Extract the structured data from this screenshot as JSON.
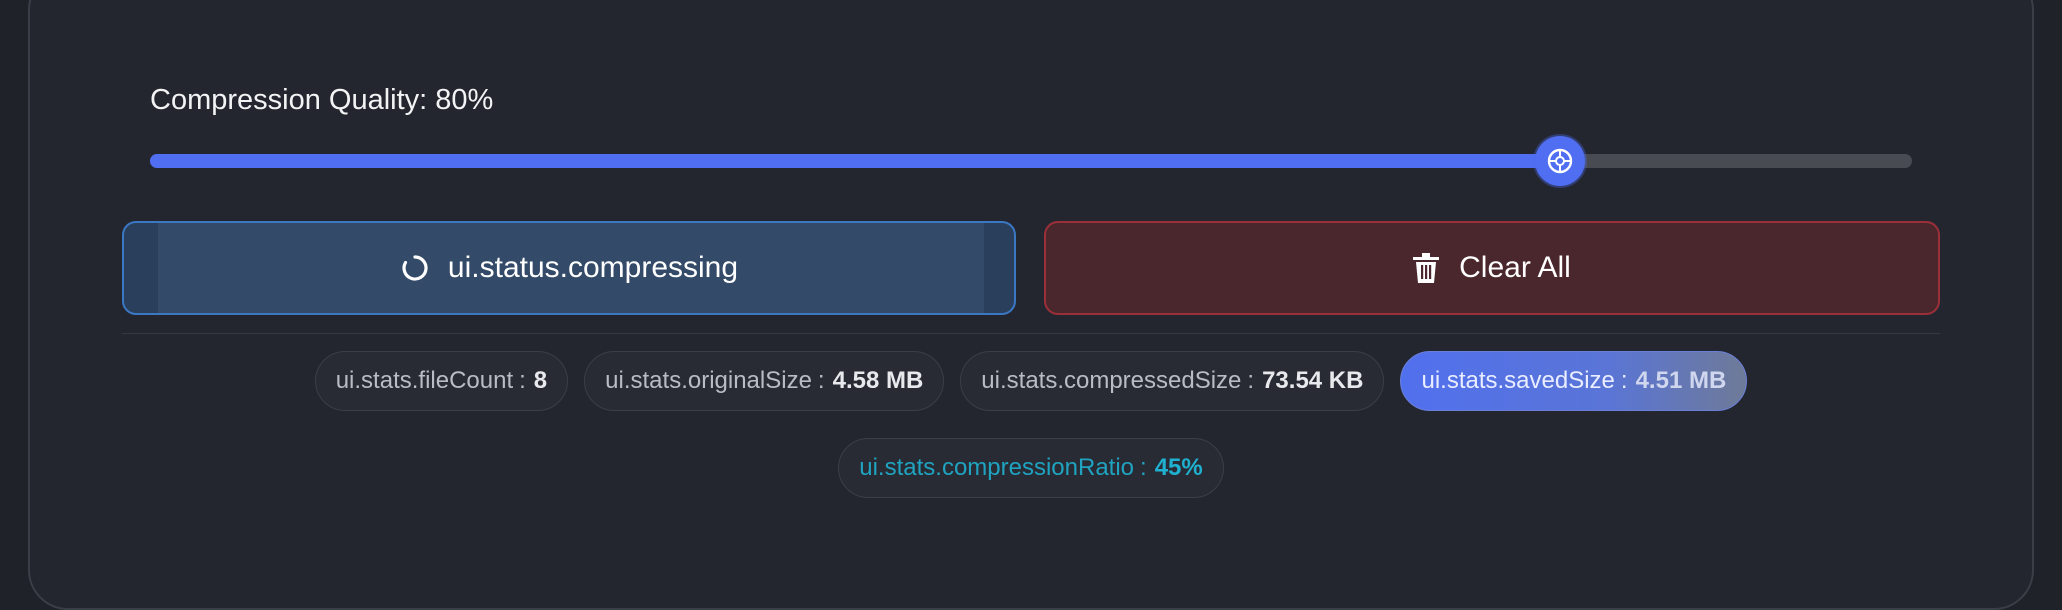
{
  "quality": {
    "label": "Compression Quality: 80%",
    "value": 80,
    "min": 0,
    "max": 100
  },
  "actions": {
    "compress_label": "ui.status.compressing",
    "clear_label": "Clear All"
  },
  "stats": [
    {
      "label": "ui.stats.fileCount",
      "sep": ":",
      "value": "8"
    },
    {
      "label": "ui.stats.originalSize",
      "sep": ":",
      "value": "4.58 MB"
    },
    {
      "label": "ui.stats.compressedSize",
      "sep": ":",
      "value": "73.54 KB"
    },
    {
      "label": "ui.stats.savedSize",
      "sep": ":",
      "value": "4.51 MB"
    },
    {
      "label": "ui.stats.compressionRatio",
      "sep": ":",
      "value": "45%"
    }
  ],
  "icons": {
    "compress": "spinner-icon",
    "clear": "trash-icon",
    "thumb": "slider-thumb-icon"
  },
  "colors": {
    "accent": "#4f6ef2",
    "danger": "#9b2f3a",
    "ratio": "#1fa3c0"
  }
}
